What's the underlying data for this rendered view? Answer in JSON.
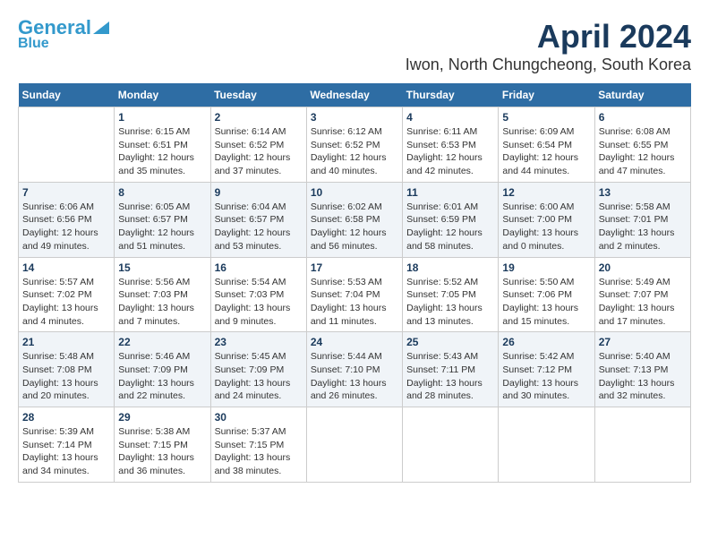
{
  "header": {
    "logo_general": "General",
    "logo_blue": "Blue",
    "month_title": "April 2024",
    "location": "Iwon, North Chungcheong, South Korea"
  },
  "weekdays": [
    "Sunday",
    "Monday",
    "Tuesday",
    "Wednesday",
    "Thursday",
    "Friday",
    "Saturday"
  ],
  "weeks": [
    [
      {
        "day": "",
        "sunrise": "",
        "sunset": "",
        "daylight": ""
      },
      {
        "day": "1",
        "sunrise": "Sunrise: 6:15 AM",
        "sunset": "Sunset: 6:51 PM",
        "daylight": "Daylight: 12 hours and 35 minutes."
      },
      {
        "day": "2",
        "sunrise": "Sunrise: 6:14 AM",
        "sunset": "Sunset: 6:52 PM",
        "daylight": "Daylight: 12 hours and 37 minutes."
      },
      {
        "day": "3",
        "sunrise": "Sunrise: 6:12 AM",
        "sunset": "Sunset: 6:52 PM",
        "daylight": "Daylight: 12 hours and 40 minutes."
      },
      {
        "day": "4",
        "sunrise": "Sunrise: 6:11 AM",
        "sunset": "Sunset: 6:53 PM",
        "daylight": "Daylight: 12 hours and 42 minutes."
      },
      {
        "day": "5",
        "sunrise": "Sunrise: 6:09 AM",
        "sunset": "Sunset: 6:54 PM",
        "daylight": "Daylight: 12 hours and 44 minutes."
      },
      {
        "day": "6",
        "sunrise": "Sunrise: 6:08 AM",
        "sunset": "Sunset: 6:55 PM",
        "daylight": "Daylight: 12 hours and 47 minutes."
      }
    ],
    [
      {
        "day": "7",
        "sunrise": "Sunrise: 6:06 AM",
        "sunset": "Sunset: 6:56 PM",
        "daylight": "Daylight: 12 hours and 49 minutes."
      },
      {
        "day": "8",
        "sunrise": "Sunrise: 6:05 AM",
        "sunset": "Sunset: 6:57 PM",
        "daylight": "Daylight: 12 hours and 51 minutes."
      },
      {
        "day": "9",
        "sunrise": "Sunrise: 6:04 AM",
        "sunset": "Sunset: 6:57 PM",
        "daylight": "Daylight: 12 hours and 53 minutes."
      },
      {
        "day": "10",
        "sunrise": "Sunrise: 6:02 AM",
        "sunset": "Sunset: 6:58 PM",
        "daylight": "Daylight: 12 hours and 56 minutes."
      },
      {
        "day": "11",
        "sunrise": "Sunrise: 6:01 AM",
        "sunset": "Sunset: 6:59 PM",
        "daylight": "Daylight: 12 hours and 58 minutes."
      },
      {
        "day": "12",
        "sunrise": "Sunrise: 6:00 AM",
        "sunset": "Sunset: 7:00 PM",
        "daylight": "Daylight: 13 hours and 0 minutes."
      },
      {
        "day": "13",
        "sunrise": "Sunrise: 5:58 AM",
        "sunset": "Sunset: 7:01 PM",
        "daylight": "Daylight: 13 hours and 2 minutes."
      }
    ],
    [
      {
        "day": "14",
        "sunrise": "Sunrise: 5:57 AM",
        "sunset": "Sunset: 7:02 PM",
        "daylight": "Daylight: 13 hours and 4 minutes."
      },
      {
        "day": "15",
        "sunrise": "Sunrise: 5:56 AM",
        "sunset": "Sunset: 7:03 PM",
        "daylight": "Daylight: 13 hours and 7 minutes."
      },
      {
        "day": "16",
        "sunrise": "Sunrise: 5:54 AM",
        "sunset": "Sunset: 7:03 PM",
        "daylight": "Daylight: 13 hours and 9 minutes."
      },
      {
        "day": "17",
        "sunrise": "Sunrise: 5:53 AM",
        "sunset": "Sunset: 7:04 PM",
        "daylight": "Daylight: 13 hours and 11 minutes."
      },
      {
        "day": "18",
        "sunrise": "Sunrise: 5:52 AM",
        "sunset": "Sunset: 7:05 PM",
        "daylight": "Daylight: 13 hours and 13 minutes."
      },
      {
        "day": "19",
        "sunrise": "Sunrise: 5:50 AM",
        "sunset": "Sunset: 7:06 PM",
        "daylight": "Daylight: 13 hours and 15 minutes."
      },
      {
        "day": "20",
        "sunrise": "Sunrise: 5:49 AM",
        "sunset": "Sunset: 7:07 PM",
        "daylight": "Daylight: 13 hours and 17 minutes."
      }
    ],
    [
      {
        "day": "21",
        "sunrise": "Sunrise: 5:48 AM",
        "sunset": "Sunset: 7:08 PM",
        "daylight": "Daylight: 13 hours and 20 minutes."
      },
      {
        "day": "22",
        "sunrise": "Sunrise: 5:46 AM",
        "sunset": "Sunset: 7:09 PM",
        "daylight": "Daylight: 13 hours and 22 minutes."
      },
      {
        "day": "23",
        "sunrise": "Sunrise: 5:45 AM",
        "sunset": "Sunset: 7:09 PM",
        "daylight": "Daylight: 13 hours and 24 minutes."
      },
      {
        "day": "24",
        "sunrise": "Sunrise: 5:44 AM",
        "sunset": "Sunset: 7:10 PM",
        "daylight": "Daylight: 13 hours and 26 minutes."
      },
      {
        "day": "25",
        "sunrise": "Sunrise: 5:43 AM",
        "sunset": "Sunset: 7:11 PM",
        "daylight": "Daylight: 13 hours and 28 minutes."
      },
      {
        "day": "26",
        "sunrise": "Sunrise: 5:42 AM",
        "sunset": "Sunset: 7:12 PM",
        "daylight": "Daylight: 13 hours and 30 minutes."
      },
      {
        "day": "27",
        "sunrise": "Sunrise: 5:40 AM",
        "sunset": "Sunset: 7:13 PM",
        "daylight": "Daylight: 13 hours and 32 minutes."
      }
    ],
    [
      {
        "day": "28",
        "sunrise": "Sunrise: 5:39 AM",
        "sunset": "Sunset: 7:14 PM",
        "daylight": "Daylight: 13 hours and 34 minutes."
      },
      {
        "day": "29",
        "sunrise": "Sunrise: 5:38 AM",
        "sunset": "Sunset: 7:15 PM",
        "daylight": "Daylight: 13 hours and 36 minutes."
      },
      {
        "day": "30",
        "sunrise": "Sunrise: 5:37 AM",
        "sunset": "Sunset: 7:15 PM",
        "daylight": "Daylight: 13 hours and 38 minutes."
      },
      {
        "day": "",
        "sunrise": "",
        "sunset": "",
        "daylight": ""
      },
      {
        "day": "",
        "sunrise": "",
        "sunset": "",
        "daylight": ""
      },
      {
        "day": "",
        "sunrise": "",
        "sunset": "",
        "daylight": ""
      },
      {
        "day": "",
        "sunrise": "",
        "sunset": "",
        "daylight": ""
      }
    ]
  ]
}
